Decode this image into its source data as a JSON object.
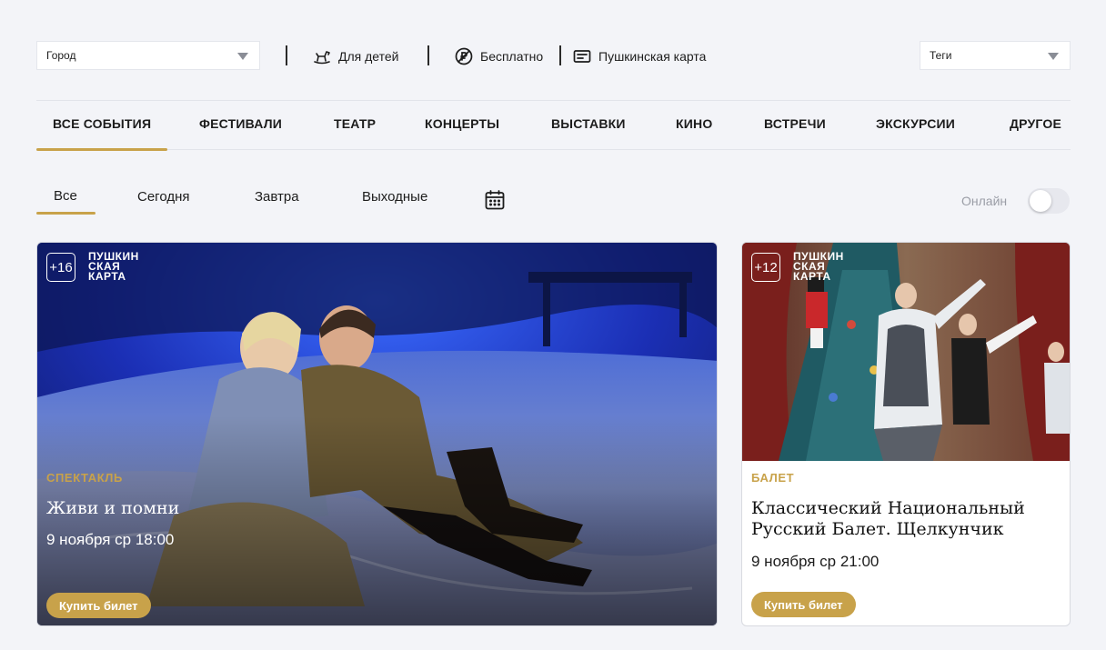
{
  "filters": {
    "city": {
      "label": "Город"
    },
    "kids": {
      "label": "Для детей",
      "icon": "rocking-horse-icon"
    },
    "free": {
      "label": "Бесплатно",
      "icon": "no-ruble-icon"
    },
    "pushkin": {
      "label": "Пушкинская карта",
      "icon": "card-icon"
    },
    "tags": {
      "label": "Теги"
    }
  },
  "categories": [
    "ВСЕ СОБЫТИЯ",
    "ФЕСТИВАЛИ",
    "ТЕАТР",
    "КОНЦЕРТЫ",
    "ВЫСТАВКИ",
    "КИНО",
    "ВСТРЕЧИ",
    "ЭКСКУРСИИ",
    "ДРУГОЕ"
  ],
  "active_category": "ВСЕ СОБЫТИЯ",
  "date_filters": [
    "Все",
    "Сегодня",
    "Завтра",
    "Выходные"
  ],
  "active_date_filter": "Все",
  "online": {
    "label": "Онлайн",
    "enabled": false
  },
  "events": [
    {
      "age": "+16",
      "badge": "ПУШКИН СКАЯ КАРТА",
      "badge_lines": [
        "ПУШКИН",
        "СКАЯ",
        "КАРТА"
      ],
      "genre": "СПЕКТАКЛЬ",
      "title": "Живи и помни",
      "date": "9 ноября ср 18:00",
      "buy": "Купить билет"
    },
    {
      "age": "+12",
      "badge": "ПУШКИН СКАЯ КАРТА",
      "badge_lines": [
        "ПУШКИН",
        "СКАЯ",
        "КАРТА"
      ],
      "genre": "БАЛЕТ",
      "title": "Классический Национальный Русский Балет. Щелкунчик",
      "date": "9 ноября ср 21:00",
      "buy": "Купить билет"
    }
  ],
  "colors": {
    "accent": "#c8a24a",
    "background": "#f3f4f8",
    "card": "#ffffff"
  }
}
